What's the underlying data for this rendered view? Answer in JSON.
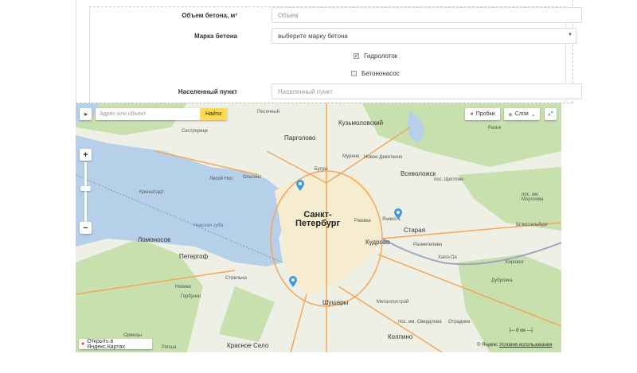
{
  "form": {
    "volume_label": "Объем бетона, м³",
    "volume_placeholder": "Объем",
    "grade_label": "Марка бетона",
    "grade_value": "выберите марку бетона",
    "hydro_label": "Гидролоток",
    "hydro_checked": true,
    "pump_label": "Бетононасос",
    "pump_checked": false,
    "city_label": "Населенный пункт",
    "city_placeholder": "Населенный пункт"
  },
  "map": {
    "search_placeholder": "Адрес или объект",
    "find_label": "Найти",
    "traffic_label": "Пробки",
    "layers_label": "Слои",
    "open_label": "Открыть в Яндекс.Картах",
    "copyright": "© Яндекс",
    "terms": "Условия использования",
    "scale": "6 км",
    "colors": {
      "water": "#b5d0e8",
      "land": "#eef0e6",
      "forest": "#c8dfae",
      "road": "#f4a65a",
      "pin": "#3b9ae1"
    },
    "labels": [
      "Песочный",
      "Кузьмоловский",
      "Сестрорецк",
      "Парголово",
      "Мурино",
      "Новое Девяткино",
      "Всеволожск",
      "Лисий Нос",
      "Кронштадт",
      "Санкт-\nПетербург",
      "Невская губа",
      "Янино-1",
      "Старая",
      "Кудрово",
      "Ломоносов",
      "Петергоф",
      "Стрельна",
      "Шушары",
      "Колпино",
      "Красное Село",
      "Металлострой",
      "Отрадное",
      "Кировск",
      "Шлиссельбург",
      "Разметелево",
      "Дубровка",
      "Ржевка",
      "пос. им. Морозова",
      "Ольгино",
      "Горбунки",
      "Низино",
      "Оржицы",
      "Ропша",
      "Разья",
      "Бугры",
      "пос. Щеглово",
      "Хапо-Ое",
      "пос. им. Свердлова"
    ]
  }
}
